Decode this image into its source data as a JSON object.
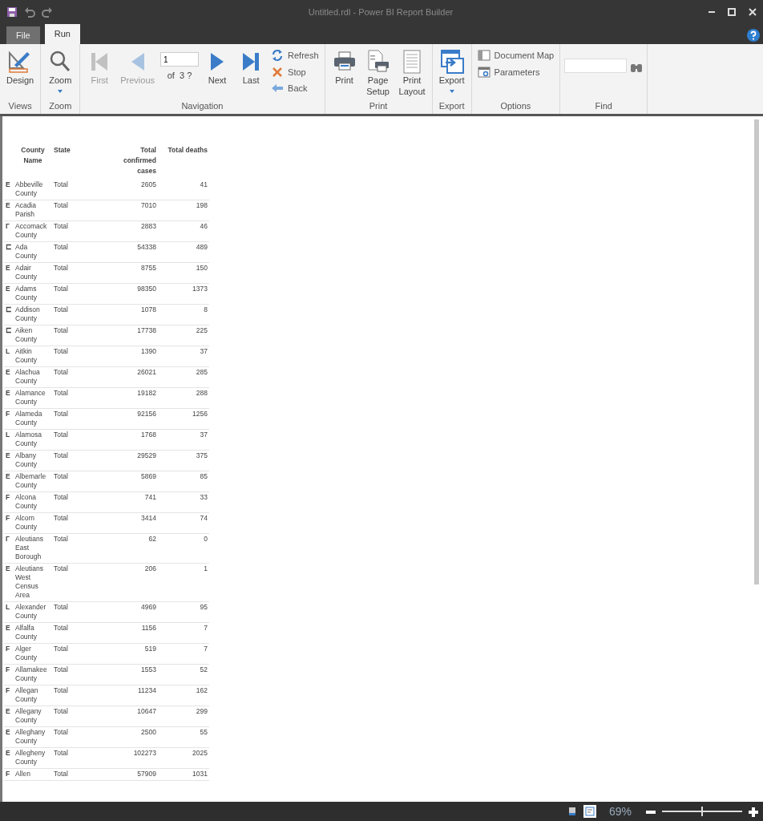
{
  "window": {
    "title": "Untitled.rdl - Power BI Report Builder"
  },
  "ribbon_tabs": [
    {
      "label": "File",
      "selected": false
    },
    {
      "label": "Run",
      "selected": true
    }
  ],
  "ribbon_groups": [
    {
      "label": "Views",
      "items": [
        {
          "kind": "big",
          "label": "Design",
          "disabled": false
        }
      ]
    },
    {
      "label": "Zoom",
      "items": [
        {
          "kind": "big",
          "label": "Zoom",
          "disabled": false,
          "dropdown": true
        }
      ]
    },
    {
      "label": "Navigation",
      "items": [
        {
          "kind": "big",
          "label": "First",
          "disabled": true
        },
        {
          "kind": "big",
          "label": "Previous",
          "disabled": true
        },
        {
          "kind": "page",
          "value": "1",
          "of": "of  3 ?"
        },
        {
          "kind": "big",
          "label": "Next",
          "disabled": false
        },
        {
          "kind": "big",
          "label": "Last",
          "disabled": false
        },
        {
          "kind": "small",
          "label": "Refresh"
        },
        {
          "kind": "small",
          "label": "Stop"
        },
        {
          "kind": "small",
          "label": "Back"
        }
      ]
    },
    {
      "label": "Print",
      "items": [
        {
          "kind": "big",
          "label": "Print",
          "disabled": false
        },
        {
          "kind": "big",
          "label": "Page Setup",
          "disabled": false
        },
        {
          "kind": "big",
          "label": "Print Layout",
          "disabled": false
        }
      ]
    },
    {
      "label": "Export",
      "items": [
        {
          "kind": "big",
          "label": "Export",
          "disabled": false,
          "dropdown": true
        }
      ]
    },
    {
      "label": "Options",
      "items": [
        {
          "kind": "small",
          "label": "Document Map"
        },
        {
          "kind": "small",
          "label": "Parameters"
        }
      ]
    },
    {
      "label": "Find",
      "items": [
        {
          "kind": "find"
        }
      ]
    }
  ],
  "report": {
    "columns": [
      "County Name",
      "State",
      "Total confirmed cases",
      "Total deaths"
    ],
    "rows": [
      {
        "marker": "E",
        "county": "Abbeville County",
        "state": "Total",
        "cases": "2605",
        "deaths": "41"
      },
      {
        "marker": "E",
        "county": "Acadia Parish",
        "state": "Total",
        "cases": "7010",
        "deaths": "198"
      },
      {
        "marker": "Г",
        "county": "Accomack County",
        "state": "Total",
        "cases": "2883",
        "deaths": "46"
      },
      {
        "marker": "⊏",
        "county": "Ada County",
        "state": "Total",
        "cases": "54338",
        "deaths": "489"
      },
      {
        "marker": "E",
        "county": "Adair County",
        "state": "Total",
        "cases": "8755",
        "deaths": "150"
      },
      {
        "marker": "E",
        "county": "Adams County",
        "state": "Total",
        "cases": "98350",
        "deaths": "1373"
      },
      {
        "marker": "⊏",
        "county": "Addison County",
        "state": "Total",
        "cases": "1078",
        "deaths": "8"
      },
      {
        "marker": "⊏",
        "county": "Aiken County",
        "state": "Total",
        "cases": "17738",
        "deaths": "225"
      },
      {
        "marker": "L",
        "county": "Aitkin County",
        "state": "Total",
        "cases": "1390",
        "deaths": "37"
      },
      {
        "marker": "E",
        "county": "Alachua County",
        "state": "Total",
        "cases": "26021",
        "deaths": "285"
      },
      {
        "marker": "E",
        "county": "Alamance County",
        "state": "Total",
        "cases": "19182",
        "deaths": "288"
      },
      {
        "marker": "F",
        "county": "Alameda County",
        "state": "Total",
        "cases": "92156",
        "deaths": "1256"
      },
      {
        "marker": "L",
        "county": "Alamosa County",
        "state": "Total",
        "cases": "1768",
        "deaths": "37"
      },
      {
        "marker": "E",
        "county": "Albany County",
        "state": "Total",
        "cases": "29529",
        "deaths": "375"
      },
      {
        "marker": "E",
        "county": "Albemarle County",
        "state": "Total",
        "cases": "5869",
        "deaths": "85"
      },
      {
        "marker": "F",
        "county": "Alcona County",
        "state": "Total",
        "cases": "741",
        "deaths": "33"
      },
      {
        "marker": "F",
        "county": "Alcorn County",
        "state": "Total",
        "cases": "3414",
        "deaths": "74"
      },
      {
        "marker": "Г",
        "county": "Aleutians East Borough",
        "state": "Total",
        "cases": "62",
        "deaths": "0"
      },
      {
        "marker": "E",
        "county": "Aleutians West Census Area",
        "state": "Total",
        "cases": "206",
        "deaths": "1"
      },
      {
        "marker": "L",
        "county": "Alexander County",
        "state": "Total",
        "cases": "4969",
        "deaths": "95"
      },
      {
        "marker": "E",
        "county": "Alfalfa County",
        "state": "Total",
        "cases": "1156",
        "deaths": "7"
      },
      {
        "marker": "F",
        "county": "Alger County",
        "state": "Total",
        "cases": "519",
        "deaths": "7"
      },
      {
        "marker": "F",
        "county": "Allamakee County",
        "state": "Total",
        "cases": "1553",
        "deaths": "52"
      },
      {
        "marker": "F",
        "county": "Allegan County",
        "state": "Total",
        "cases": "11234",
        "deaths": "162"
      },
      {
        "marker": "E",
        "county": "Allegany County",
        "state": "Total",
        "cases": "10647",
        "deaths": "299"
      },
      {
        "marker": "E",
        "county": "Alleghany County",
        "state": "Total",
        "cases": "2500",
        "deaths": "55"
      },
      {
        "marker": "E",
        "county": "Allegheny County",
        "state": "Total",
        "cases": "102273",
        "deaths": "2025"
      },
      {
        "marker": "F",
        "county": "Allen",
        "state": "Total",
        "cases": "57909",
        "deaths": "1031"
      }
    ]
  },
  "status_bar": {
    "view_buttons": [
      {
        "selected": false
      },
      {
        "selected": true
      }
    ],
    "zoom": "69%",
    "zoom_slider": {
      "level": 0.5
    }
  }
}
